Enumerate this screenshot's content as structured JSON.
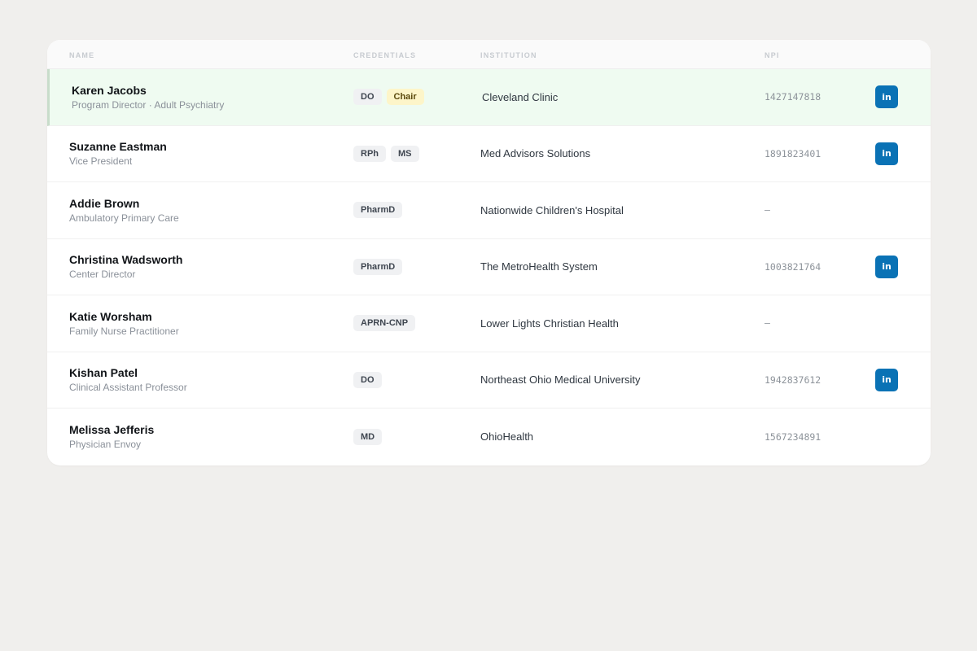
{
  "table": {
    "headers": {
      "name": "NAME",
      "credentials": "CREDENTIALS",
      "institution": "INSTITUTION",
      "npi": "NPI"
    },
    "rows": [
      {
        "name": "Karen Jacobs",
        "role": "Program Director · Adult Psychiatry",
        "credentials": [
          "DO",
          "Chair"
        ],
        "institution": "Cleveland Clinic",
        "npi": "1427147818",
        "linkedin": "in",
        "highlighted": true
      },
      {
        "name": "Suzanne Eastman",
        "role": "Vice President",
        "credentials": [
          "RPh",
          "MS"
        ],
        "institution": "Med Advisors Solutions",
        "npi": "1891823401",
        "linkedin": "in"
      },
      {
        "name": "Addie Brown",
        "role": "Ambulatory Primary Care",
        "credentials": [
          "PharmD"
        ],
        "institution": "Nationwide Children's Hospital",
        "npi": "—"
      },
      {
        "name": "Christina Wadsworth",
        "role": "Center Director",
        "credentials": [
          "PharmD"
        ],
        "institution": "The MetroHealth System",
        "npi": "1003821764",
        "linkedin": "in"
      },
      {
        "name": "Katie Worsham",
        "role": "Family Nurse Practitioner",
        "credentials": [
          "APRN-CNP"
        ],
        "institution": "Lower Lights Christian Health",
        "npi": "—"
      },
      {
        "name": "Kishan Patel",
        "role": "Clinical Assistant Professor",
        "credentials": [
          "DO"
        ],
        "institution": "Northeast Ohio Medical University",
        "npi": "1942837612",
        "linkedin": "in"
      },
      {
        "name": "Melissa Jefferis",
        "role": "Physician Envoy",
        "credentials": [
          "MD"
        ],
        "institution": "OhioHealth",
        "npi": "1567234891"
      }
    ]
  },
  "colors": {
    "linkedin": "#0a72b5",
    "highlight_row": "#effbf1",
    "chair_badge": "#fdf5c9"
  },
  "icons": {
    "linkedin": "linkedin-icon"
  }
}
